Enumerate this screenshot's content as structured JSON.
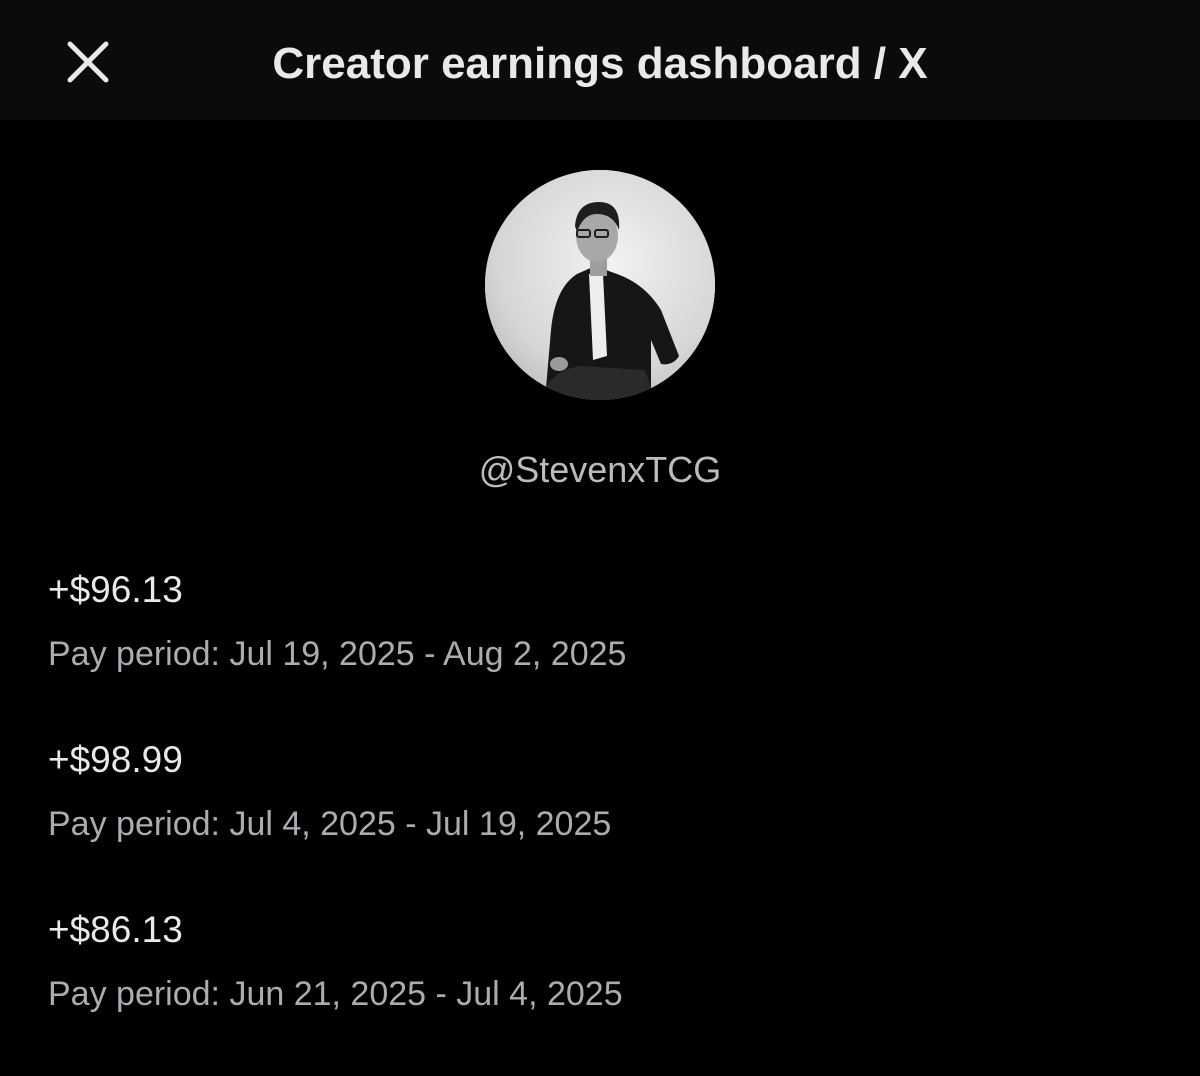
{
  "header": {
    "title": "Creator earnings dashboard / X",
    "close_icon": "close-icon"
  },
  "profile": {
    "handle": "@StevenxTCG",
    "avatar_icon": "profile-photo"
  },
  "payouts": [
    {
      "amount": "+$96.13",
      "period": "Pay period: Jul 19, 2025 - Aug 2, 2025"
    },
    {
      "amount": "+$98.99",
      "period": "Pay period: Jul 4, 2025 - Jul 19, 2025"
    },
    {
      "amount": "+$86.13",
      "period": "Pay period: Jun 21, 2025 - Jul 4, 2025"
    }
  ],
  "colors": {
    "background": "#000000",
    "header_background": "#0b0b0b",
    "primary_text": "#e7e9ea",
    "secondary_text": "#a9adb1"
  }
}
